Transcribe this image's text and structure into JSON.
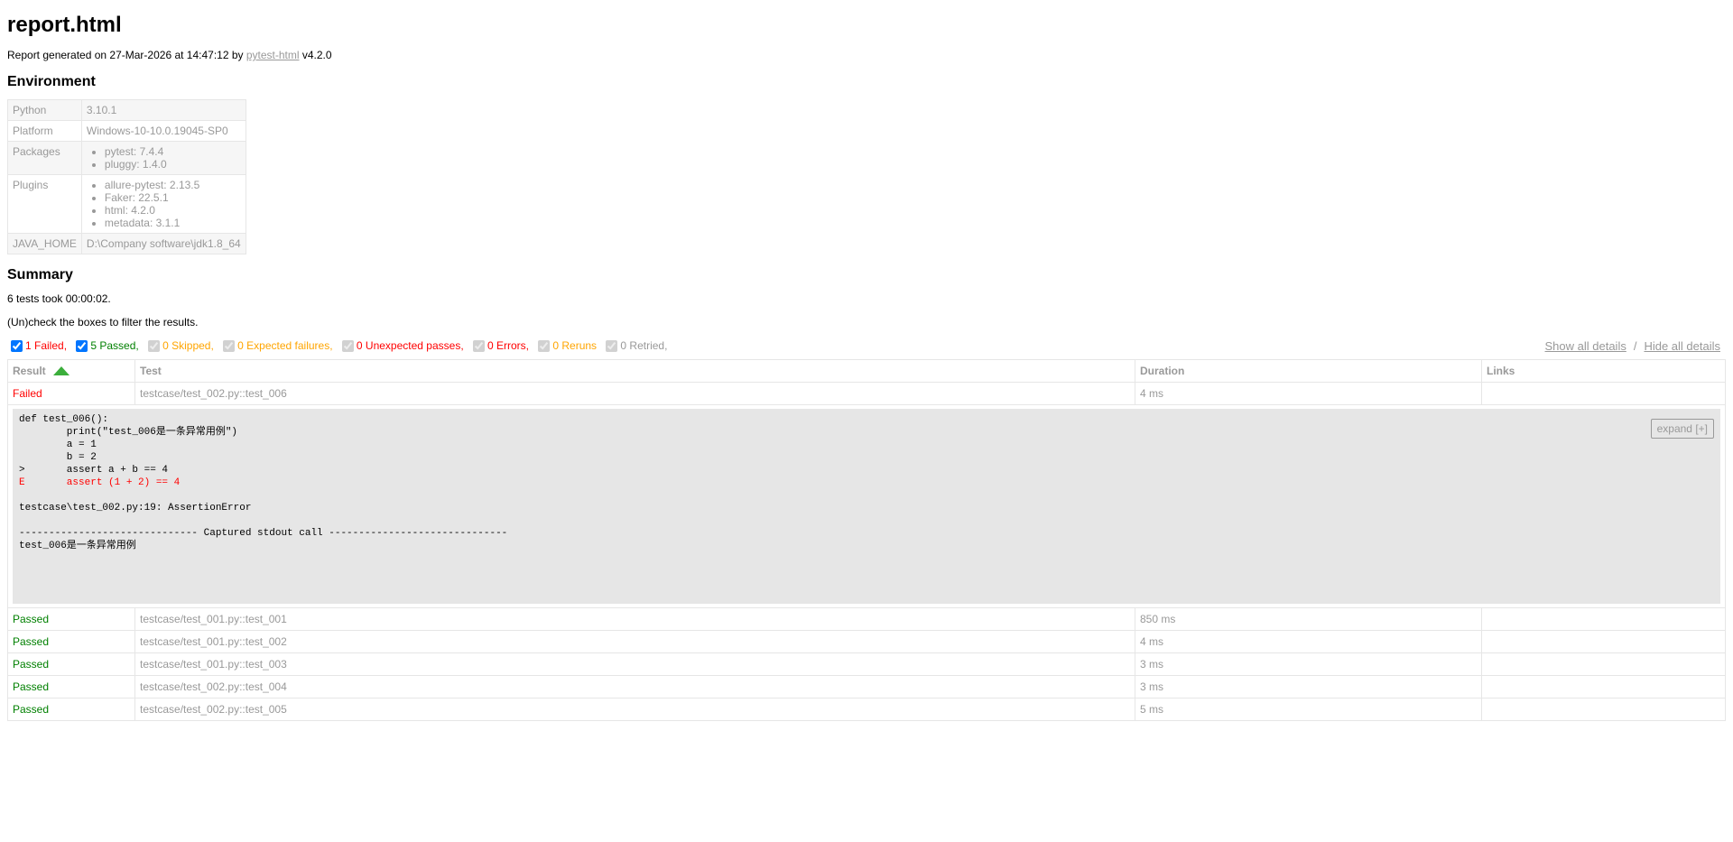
{
  "title": "report.html",
  "generated": {
    "prefix": "Report generated on 27-Mar-2026 at 14:47:12 by ",
    "link": "pytest-html",
    "suffix": " v4.2.0"
  },
  "environment": {
    "heading": "Environment",
    "python_label": "Python",
    "python_value": "3.10.1",
    "platform_label": "Platform",
    "platform_value": "Windows-10-10.0.19045-SP0",
    "packages_label": "Packages",
    "packages": [
      "pytest: 7.4.4",
      "pluggy: 1.4.0"
    ],
    "plugins_label": "Plugins",
    "plugins": [
      "allure-pytest: 2.13.5",
      "Faker: 22.5.1",
      "html: 4.2.0",
      "metadata: 3.1.1"
    ],
    "java_label": "JAVA_HOME",
    "java_value": "D:\\Company software\\jdk1.8_64"
  },
  "summary": {
    "heading": "Summary",
    "took": "6 tests took 00:00:02.",
    "hint": "(Un)check the boxes to filter the results.",
    "filters": [
      {
        "label": "1 Failed,",
        "checked": true,
        "enabled": true
      },
      {
        "label": "5 Passed,",
        "checked": true,
        "enabled": true
      },
      {
        "label": "0 Skipped,",
        "checked": true,
        "enabled": false
      },
      {
        "label": "0 Expected failures,",
        "checked": true,
        "enabled": false
      },
      {
        "label": "0 Unexpected passes,",
        "checked": true,
        "enabled": false
      },
      {
        "label": "0 Errors,",
        "checked": true,
        "enabled": false
      },
      {
        "label": "0 Reruns",
        "checked": true,
        "enabled": false
      },
      {
        "label": "0 Retried,",
        "checked": true,
        "enabled": false
      }
    ],
    "show_all": "Show all details",
    "separator": "/",
    "hide_all": "Hide all details"
  },
  "results": {
    "headers": {
      "result": "Result",
      "test": "Test",
      "duration": "Duration",
      "links": "Links"
    },
    "failed_row": {
      "result": "Failed",
      "test": "testcase/test_002.py::test_006",
      "duration": "4 ms",
      "links": ""
    },
    "log": {
      "lines": [
        "def test_006():",
        "        print(\"test_006是一条异常用例\")",
        "        a = 1",
        "        b = 2",
        ">       assert a + b == 4"
      ],
      "error_line": "E       assert (1 + 2) == 4",
      "location": "testcase\\test_002.py:19: AssertionError",
      "captured": "------------------------------ Captured stdout call ------------------------------",
      "stdout": "test_006是一条异常用例",
      "expand": "expand [+]"
    },
    "rows": [
      {
        "result": "Passed",
        "test": "testcase/test_001.py::test_001",
        "duration": "850 ms",
        "links": ""
      },
      {
        "result": "Passed",
        "test": "testcase/test_001.py::test_002",
        "duration": "4 ms",
        "links": ""
      },
      {
        "result": "Passed",
        "test": "testcase/test_001.py::test_003",
        "duration": "3 ms",
        "links": ""
      },
      {
        "result": "Passed",
        "test": "testcase/test_002.py::test_004",
        "duration": "3 ms",
        "links": ""
      },
      {
        "result": "Passed",
        "test": "testcase/test_002.py::test_005",
        "duration": "5 ms",
        "links": ""
      }
    ]
  },
  "colors": {
    "failed": "#ff0000",
    "passed": "#008000",
    "skipped": "#ffa500",
    "muted": "#999999",
    "log_bg": "#e6e6e6",
    "sort_arrow": "#3bae3b"
  }
}
